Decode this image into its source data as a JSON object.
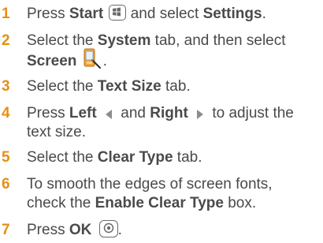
{
  "steps": [
    {
      "num": "1",
      "t1": "Press ",
      "b1": "Start",
      "t2": " and select ",
      "b2": "Settings",
      "t3": ".",
      "icon": "start-menu-icon"
    },
    {
      "num": "2",
      "t1": "Select the ",
      "b1": "System",
      "t2": " tab, and then select",
      "b2": "Screen",
      "t3": ".",
      "icon": "screen-settings-icon"
    },
    {
      "num": "3",
      "t1": "Select the ",
      "b1": "Text Size",
      "t2": " tab."
    },
    {
      "num": "4",
      "t1": "Press ",
      "b1": "Left",
      "t2": " and ",
      "b2": "Right",
      "t3": " to adjust the",
      "t4": "text size.",
      "icon": "left-arrow-icon",
      "icon2": "right-arrow-icon"
    },
    {
      "num": "5",
      "t1": "Select the ",
      "b1": "Clear Type",
      "t2": " tab."
    },
    {
      "num": "6",
      "t1": "To smooth the edges of screen fonts,",
      "t2": "check the ",
      "b1": "Enable Clear Type",
      "t3": " box."
    },
    {
      "num": "7",
      "t1": "Press ",
      "b1": "OK",
      "t2": ".",
      "icon": "ok-button-icon"
    }
  ],
  "colors": {
    "number": "#e58f12",
    "text": "#4a4a4a"
  }
}
